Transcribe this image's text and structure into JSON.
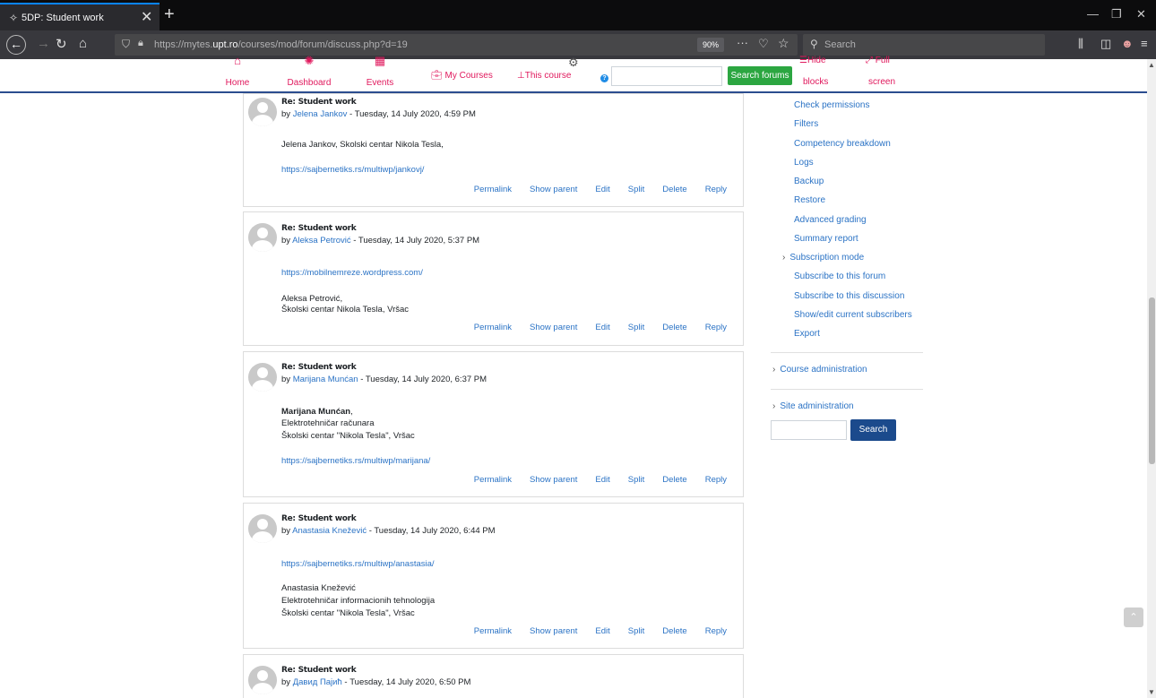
{
  "browser": {
    "tab_title": "5DP: Student work",
    "tab_close": "✕",
    "new_tab": "+",
    "url_prefix": "https://mytes.",
    "url_domain": "upt.ro",
    "url_path": "/courses/mod/forum/discuss.php?d=19",
    "zoom": "90%",
    "search_placeholder": "Search"
  },
  "moodle_nav": {
    "home": "Home",
    "dashboard": "Dashboard",
    "events": "Events",
    "my_courses": "My Courses",
    "this_course": "This course",
    "search_forums": "Search forums",
    "hide_blocks_1": "Hide",
    "hide_blocks_2": "blocks",
    "full_screen_1": "Full",
    "full_screen_2": "screen"
  },
  "posts": [
    {
      "subject": "Re: Student work",
      "by": "by ",
      "author": "Jelena Jankov",
      "date": " - Tuesday, 14 July 2020, 4:59 PM",
      "lines": [
        "Jelena Jankov, Skolski centar Nikola Tesla,"
      ],
      "link": "https://sajbernetiks.rs/multiwp/jankovj/"
    },
    {
      "subject": "Re: Student work",
      "by": "by ",
      "author": "Aleksa Petrović",
      "date": " - Tuesday, 14 July 2020, 5:37 PM",
      "link": "https://mobilnemreze.wordpress.com/",
      "lines": [
        "Aleksa Petrović,",
        "Školski centar Nikola Tesla, Vršac"
      ]
    },
    {
      "subject": "Re: Student work",
      "by": "by ",
      "author": "Marijana Munćan",
      "date": " - Tuesday, 14 July 2020, 6:37 PM",
      "bold_line": "Marijana Munćan",
      "bold_suffix": ",",
      "lines": [
        "Elektrotehničar računara",
        "Školski centar \"Nikola Tesla\", Vršac"
      ],
      "link": "https://sajbernetiks.rs/multiwp/marijana/"
    },
    {
      "subject": "Re: Student work",
      "by": "by ",
      "author": "Anastasia Knežević",
      "date": " - Tuesday, 14 July 2020, 6:44 PM",
      "link": "https://sajbernetiks.rs/multiwp/anastasia/",
      "lines": [
        "Anastasia Knežević",
        "Elektrotehničar informacionih tehnologija",
        "Školski centar \"Nikola Tesla\", Vršac"
      ]
    },
    {
      "subject": "Re: Student work",
      "by": "by ",
      "author": "Давид Пајић",
      "date": " - Tuesday, 14 July 2020, 6:50 PM"
    }
  ],
  "post_actions": {
    "permalink": "Permalink",
    "show_parent": "Show parent",
    "edit": "Edit",
    "split": "Split",
    "delete": "Delete",
    "reply": "Reply"
  },
  "admin_nav": {
    "items": [
      "Check permissions",
      "Filters",
      "Competency breakdown",
      "Logs",
      "Backup",
      "Restore",
      "Advanced grading",
      "Summary report",
      "Subscription mode",
      "Subscribe to this forum",
      "Subscribe to this discussion",
      "Show/edit current subscribers",
      "Export"
    ],
    "course_administration": "Course administration",
    "site_administration": "Site administration",
    "search_button": "Search"
  }
}
